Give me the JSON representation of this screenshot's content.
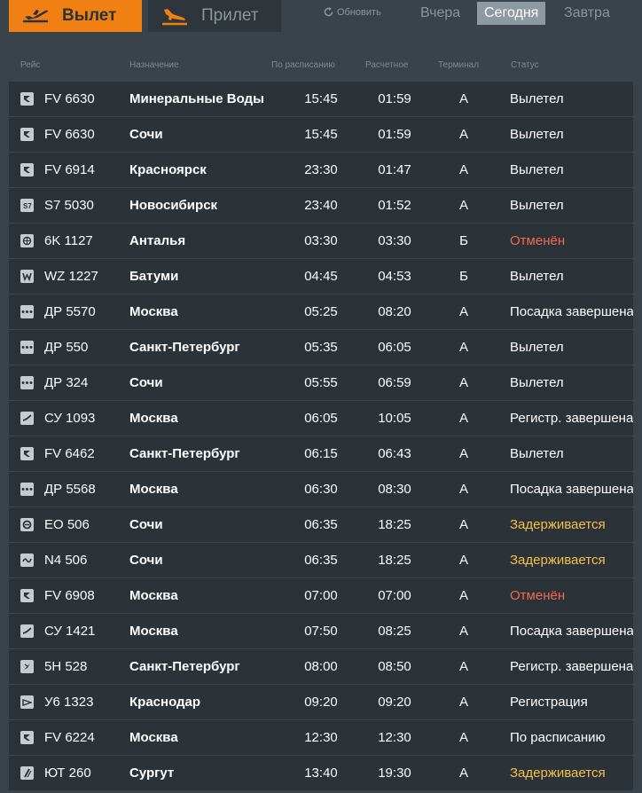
{
  "tabs": {
    "departures": "Вылет",
    "arrivals": "Прилет"
  },
  "refresh_label": "Обновить",
  "days": {
    "yesterday": "Вчера",
    "today": "Сегодня",
    "tomorrow": "Завтра"
  },
  "columns": {
    "flight": "Рейс",
    "destination": "Назначение",
    "scheduled": "По расписанию",
    "estimated": "Расчетное",
    "terminal": "Терминал",
    "status": "Статус"
  },
  "colors": {
    "accent": "#f08012",
    "cancelled": "#f06a4e",
    "delayed": "#f3c14b"
  },
  "flights": [
    {
      "airline_icon": "nordwind-icon",
      "flight": "FV 6630",
      "destination": "Минеральные Воды",
      "scheduled": "15:45",
      "estimated": "01:59",
      "terminal": "A",
      "status": "Вылетел",
      "state": "normal"
    },
    {
      "airline_icon": "nordwind-icon",
      "flight": "FV 6630",
      "destination": "Сочи",
      "scheduled": "15:45",
      "estimated": "01:59",
      "terminal": "A",
      "status": "Вылетел",
      "state": "normal"
    },
    {
      "airline_icon": "nordwind-icon",
      "flight": "FV 6914",
      "destination": "Красноярск",
      "scheduled": "23:30",
      "estimated": "01:47",
      "terminal": "A",
      "status": "Вылетел",
      "state": "normal"
    },
    {
      "airline_icon": "s7-icon",
      "flight": "S7 5030",
      "destination": "Новосибирск",
      "scheduled": "23:40",
      "estimated": "01:52",
      "terminal": "A",
      "status": "Вылетел",
      "state": "normal"
    },
    {
      "airline_icon": "globe-icon",
      "flight": "6K 1127",
      "destination": "Анталья",
      "scheduled": "03:30",
      "estimated": "03:30",
      "terminal": "Б",
      "status": "Отменён",
      "state": "cancelled"
    },
    {
      "airline_icon": "wizz-icon",
      "flight": "WZ 1227",
      "destination": "Батуми",
      "scheduled": "04:45",
      "estimated": "04:53",
      "terminal": "Б",
      "status": "Вылетел",
      "state": "normal"
    },
    {
      "airline_icon": "dots-icon",
      "flight": "ДР 5570",
      "destination": "Москва",
      "scheduled": "05:25",
      "estimated": "08:20",
      "terminal": "A",
      "status": "Посадка завершена",
      "state": "normal"
    },
    {
      "airline_icon": "dots-icon",
      "flight": "ДР 550",
      "destination": "Санкт-Петербург",
      "scheduled": "05:35",
      "estimated": "06:05",
      "terminal": "A",
      "status": "Вылетел",
      "state": "normal"
    },
    {
      "airline_icon": "dots-icon",
      "flight": "ДР 324",
      "destination": "Сочи",
      "scheduled": "05:55",
      "estimated": "06:59",
      "terminal": "A",
      "status": "Вылетел",
      "state": "normal"
    },
    {
      "airline_icon": "swoosh-icon",
      "flight": "СУ 1093",
      "destination": "Москва",
      "scheduled": "06:05",
      "estimated": "10:05",
      "terminal": "A",
      "status": "Регистр. завершена",
      "state": "normal"
    },
    {
      "airline_icon": "nordwind-icon",
      "flight": "FV 6462",
      "destination": "Санкт-Петербург",
      "scheduled": "06:15",
      "estimated": "06:43",
      "terminal": "A",
      "status": "Вылетел",
      "state": "normal"
    },
    {
      "airline_icon": "dots-icon",
      "flight": "ДР 5568",
      "destination": "Москва",
      "scheduled": "06:30",
      "estimated": "08:30",
      "terminal": "A",
      "status": "Посадка завершена",
      "state": "normal"
    },
    {
      "airline_icon": "circle-logo-icon",
      "flight": "EO 506",
      "destination": "Сочи",
      "scheduled": "06:35",
      "estimated": "18:25",
      "terminal": "A",
      "status": "Задерживается",
      "state": "delayed"
    },
    {
      "airline_icon": "wave-icon",
      "flight": "N4 506",
      "destination": "Сочи",
      "scheduled": "06:35",
      "estimated": "18:25",
      "terminal": "A",
      "status": "Задерживается",
      "state": "delayed"
    },
    {
      "airline_icon": "nordwind-icon",
      "flight": "FV 6908",
      "destination": "Москва",
      "scheduled": "07:00",
      "estimated": "07:00",
      "terminal": "A",
      "status": "Отменён",
      "state": "cancelled"
    },
    {
      "airline_icon": "swoosh-icon",
      "flight": "СУ 1421",
      "destination": "Москва",
      "scheduled": "07:50",
      "estimated": "08:25",
      "terminal": "A",
      "status": "Посадка завершена",
      "state": "normal"
    },
    {
      "airline_icon": "bird-icon",
      "flight": "5H 528",
      "destination": "Санкт-Петербург",
      "scheduled": "08:00",
      "estimated": "08:50",
      "terminal": "A",
      "status": "Регистр. завершена",
      "state": "normal"
    },
    {
      "airline_icon": "ural-icon",
      "flight": "У6 1323",
      "destination": "Краснодар",
      "scheduled": "09:20",
      "estimated": "09:20",
      "terminal": "A",
      "status": "Регистрация",
      "state": "normal"
    },
    {
      "airline_icon": "nordwind-icon",
      "flight": "FV 6224",
      "destination": "Москва",
      "scheduled": "12:30",
      "estimated": "12:30",
      "terminal": "A",
      "status": "По расписанию",
      "state": "normal"
    },
    {
      "airline_icon": "slash-icon",
      "flight": "ЮТ 260",
      "destination": "Сургут",
      "scheduled": "13:40",
      "estimated": "19:30",
      "terminal": "A",
      "status": "Задерживается",
      "state": "delayed"
    }
  ]
}
